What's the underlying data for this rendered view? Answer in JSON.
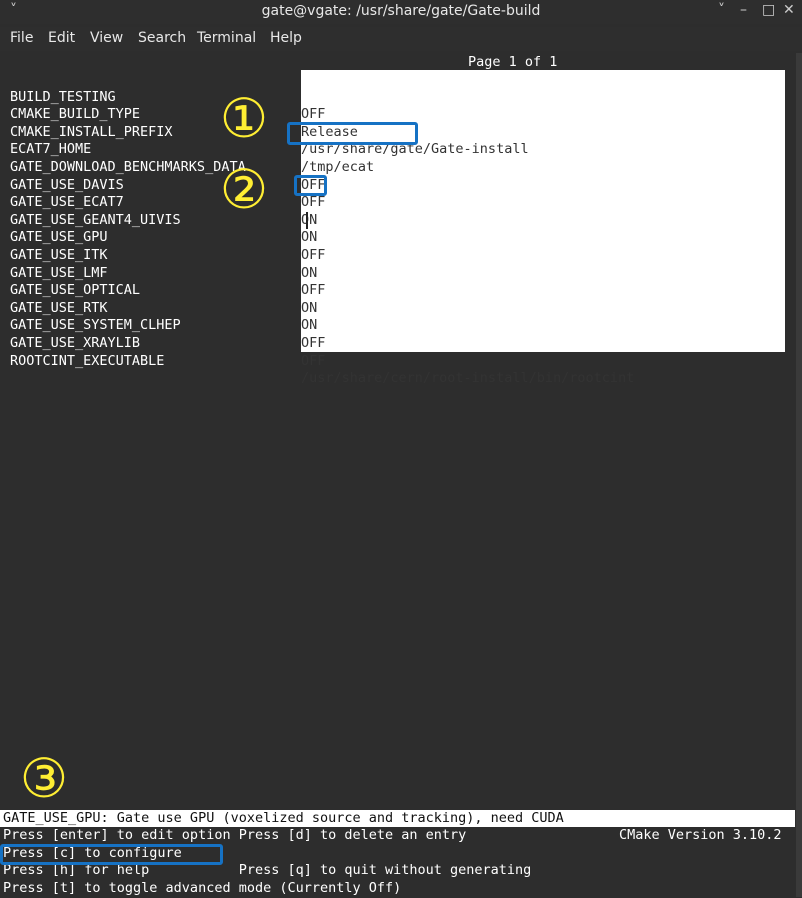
{
  "window": {
    "title": "gate@vgate: /usr/share/gate/Gate-build",
    "menu_chevron": "˅",
    "control_chevron": "˅",
    "minimize": "–",
    "maximize": "□",
    "close": "✕"
  },
  "menu": [
    "File",
    "Edit",
    "View",
    "Search",
    "Terminal",
    "Help"
  ],
  "ccmake": {
    "page_indicator": "Page 1 of 1",
    "entries": [
      {
        "key": "BUILD_TESTING",
        "value": "OFF"
      },
      {
        "key": "CMAKE_BUILD_TYPE",
        "value": "Release"
      },
      {
        "key": "CMAKE_INSTALL_PREFIX",
        "value": "/usr/share/gate/Gate-install"
      },
      {
        "key": "ECAT7_HOME",
        "value": "/tmp/ecat"
      },
      {
        "key": "GATE_DOWNLOAD_BENCHMARKS_DATA",
        "value": "OFF"
      },
      {
        "key": "GATE_USE_DAVIS",
        "value": "OFF"
      },
      {
        "key": "GATE_USE_ECAT7",
        "value": "ON"
      },
      {
        "key": "GATE_USE_GEANT4_UIVIS",
        "value": "ON"
      },
      {
        "key": "GATE_USE_GPU",
        "value": "OFF"
      },
      {
        "key": "GATE_USE_ITK",
        "value": "ON"
      },
      {
        "key": "GATE_USE_LMF",
        "value": "OFF"
      },
      {
        "key": "GATE_USE_OPTICAL",
        "value": "ON"
      },
      {
        "key": "GATE_USE_RTK",
        "value": "ON"
      },
      {
        "key": "GATE_USE_SYSTEM_CLHEP",
        "value": "OFF"
      },
      {
        "key": "GATE_USE_XRAYLIB",
        "value": "OFF"
      },
      {
        "key": "ROOTCINT_EXECUTABLE",
        "value": "/usr/share/cern/root-install/bin/rootcint"
      }
    ],
    "status_line": "GATE_USE_GPU: Gate use GPU (voxelized source and tracking), need CUDA",
    "help_lines": {
      "l1_left": "Press [enter] to edit option Press [d] to delete an entry",
      "l1_right": "CMake Version 3.10.2",
      "l2": "Press [c] to configure",
      "l3": "Press [h] for help           Press [q] to quit without generating",
      "l4": "Press [t] to toggle advanced mode (Currently Off)"
    }
  },
  "annotations": {
    "badge1": "①",
    "badge2": "②",
    "badge3": "③",
    "badge_color": "#ffee33",
    "box_color": "#1672c4"
  }
}
